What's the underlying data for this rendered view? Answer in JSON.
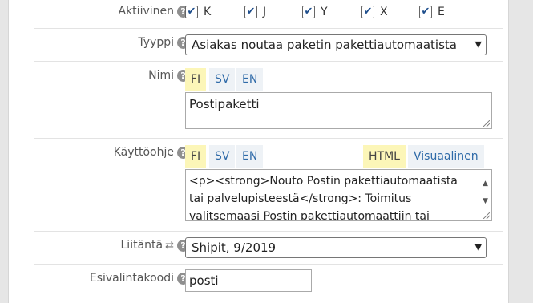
{
  "fields": {
    "active": {
      "label": "Aktiivinen",
      "options": [
        {
          "label": "K",
          "checked": true
        },
        {
          "label": "J",
          "checked": true
        },
        {
          "label": "Y",
          "checked": true
        },
        {
          "label": "X",
          "checked": true
        },
        {
          "label": "E",
          "checked": true
        }
      ]
    },
    "type": {
      "label": "Tyyppi",
      "value": "Asiakas noutaa paketin pakettiautomaatista"
    },
    "name": {
      "label": "Nimi",
      "langs": [
        "FI",
        "SV",
        "EN"
      ],
      "active_lang": "FI",
      "value": "Postipaketti"
    },
    "instructions": {
      "label": "Käyttöohje",
      "langs": [
        "FI",
        "SV",
        "EN"
      ],
      "active_lang": "FI",
      "modes": [
        "HTML",
        "Visuaalinen"
      ],
      "active_mode": "HTML",
      "lines": [
        "<p><strong>Nouto Postin pakettiautomaatista",
        "tai palvelupisteestä</strong>: Toimitus",
        "valitsemaasi Postin pakettiautomaattiin tai"
      ]
    },
    "integration": {
      "label": "Liitäntä",
      "sync_icon": "⇄",
      "value": "Shipit, 9/2019"
    },
    "preset_code": {
      "label": "Esivalintakoodi",
      "value": "posti"
    }
  },
  "icons": {
    "help": "?",
    "check": "✔",
    "chevron": "▼"
  },
  "colors": {
    "active_tab": "#fcf6b8",
    "link": "#2e6aa8",
    "checkbox": "#1e4e8c"
  }
}
